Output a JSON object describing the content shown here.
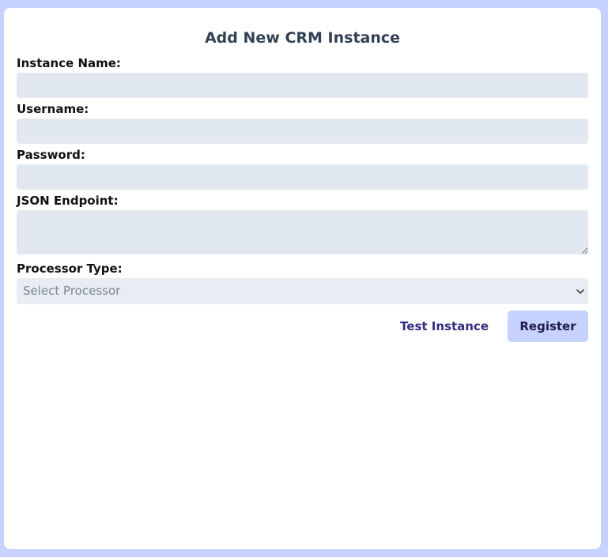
{
  "form": {
    "title": "Add New CRM Instance",
    "instance_name": {
      "label": "Instance Name:",
      "value": ""
    },
    "username": {
      "label": "Username:",
      "value": ""
    },
    "password": {
      "label": "Password:",
      "value": ""
    },
    "json_endpoint": {
      "label": "JSON Endpoint:",
      "value": ""
    },
    "processor_type": {
      "label": "Processor Type:",
      "selected": "Select Processor",
      "icon": "chevron-down-icon"
    }
  },
  "actions": {
    "test_label": "Test Instance",
    "register_label": "Register"
  },
  "colors": {
    "background": "#c7d2fe",
    "card": "#ffffff",
    "input": "#e2e8f0",
    "title": "#334155",
    "link": "#312e81",
    "primary_button": "#c7d2fe"
  }
}
